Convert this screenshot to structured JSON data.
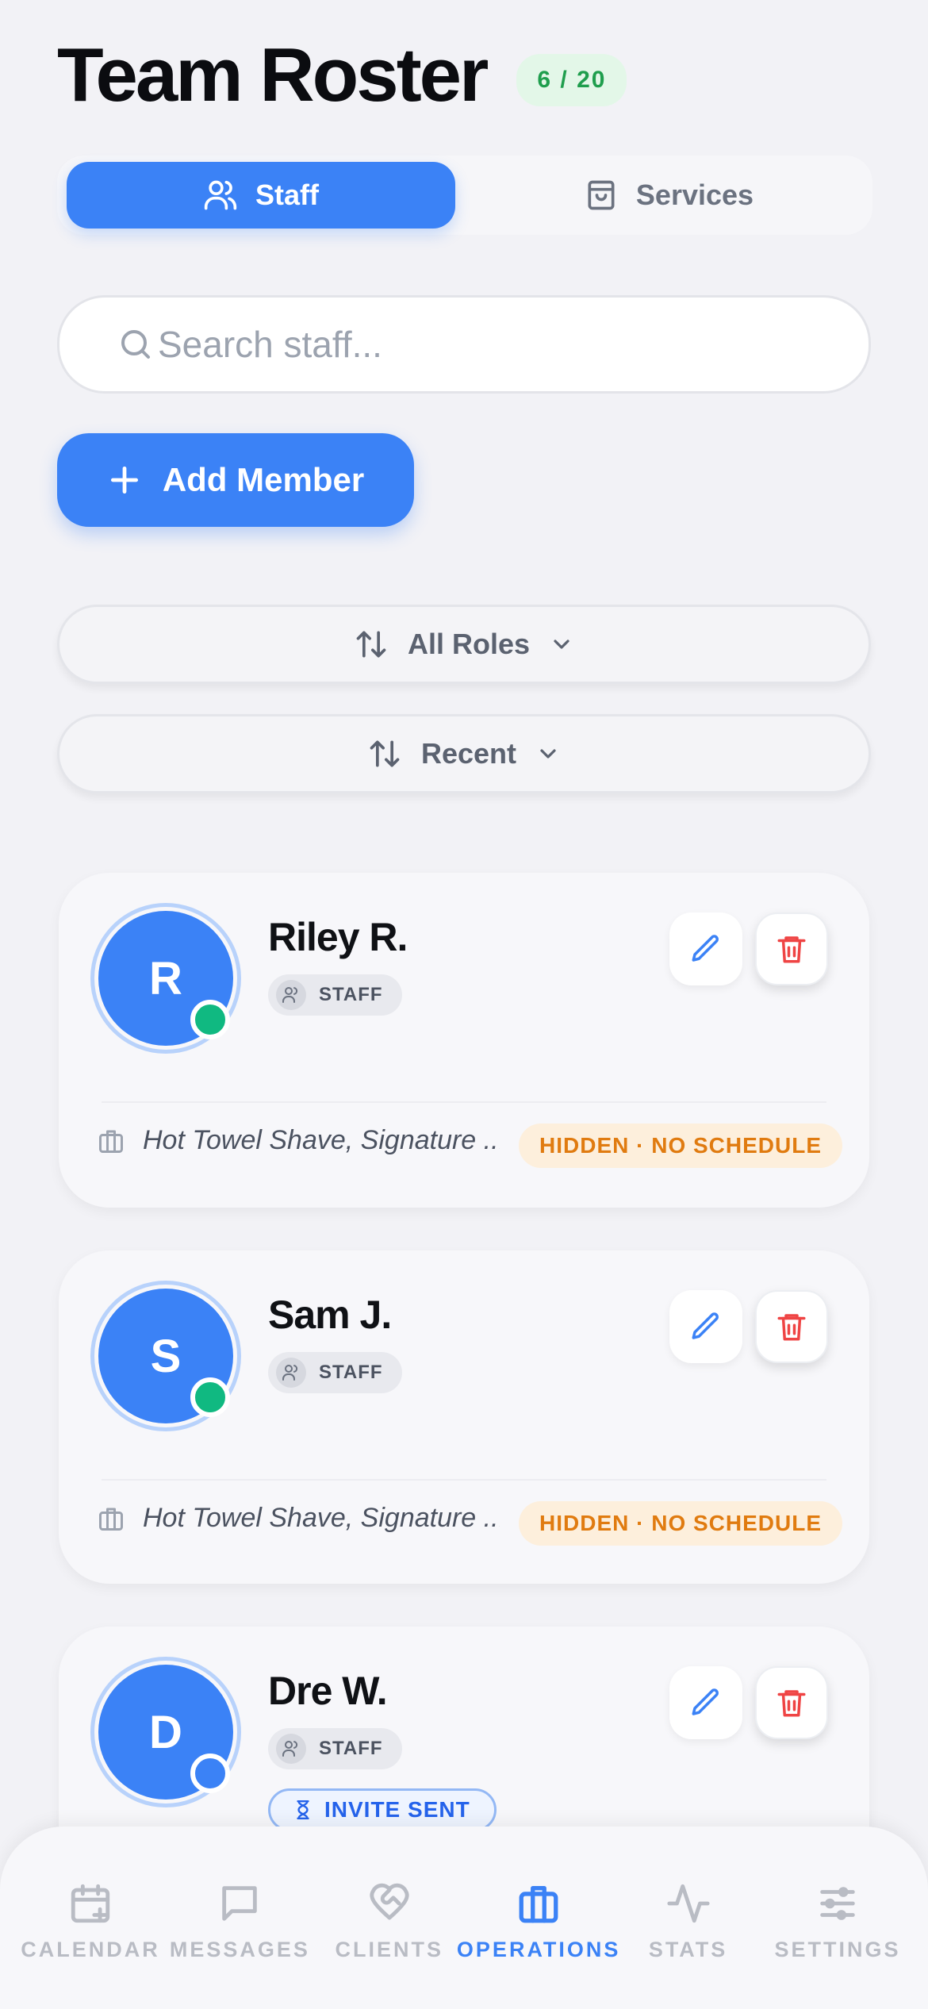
{
  "header": {
    "title": "Team Roster",
    "count": "6 / 20"
  },
  "tabs": [
    {
      "label": "Staff",
      "icon": "users-icon",
      "active": true
    },
    {
      "label": "Services",
      "icon": "shopping-bag-icon",
      "active": false
    }
  ],
  "search": {
    "placeholder": "Search staff...",
    "value": ""
  },
  "add_button": {
    "label": "Add Member"
  },
  "filters": {
    "roles": {
      "label": "All Roles"
    },
    "sort": {
      "label": "Recent"
    }
  },
  "members": [
    {
      "initial": "R",
      "name": "Riley R.",
      "role": "STAFF",
      "status_color": "#10b981",
      "services": "Hot Towel Shave, Signature ...",
      "badge": "HIDDEN · NO SCHEDULE"
    },
    {
      "initial": "S",
      "name": "Sam J.",
      "role": "STAFF",
      "status_color": "#10b981",
      "services": "Hot Towel Shave, Signature ...",
      "badge": "HIDDEN · NO SCHEDULE"
    },
    {
      "initial": "D",
      "name": "Dre W.",
      "role": "STAFF",
      "status_color": "#3b82f6",
      "invite": "INVITE SENT"
    }
  ],
  "nav": [
    {
      "label": "CALENDAR",
      "icon": "calendar-plus-icon",
      "active": false
    },
    {
      "label": "MESSAGES",
      "icon": "message-square-icon",
      "active": false
    },
    {
      "label": "CLIENTS",
      "icon": "heart-handshake-icon",
      "active": false
    },
    {
      "label": "OPERATIONS",
      "icon": "briefcase-icon",
      "active": true
    },
    {
      "label": "STATS",
      "icon": "activity-icon",
      "active": false
    },
    {
      "label": "SETTINGS",
      "icon": "sliders-icon",
      "active": false
    }
  ],
  "colors": {
    "accent": "#3b82f6",
    "online": "#10b981",
    "danger": "#ef4444",
    "warning_text": "#e07b10",
    "warning_bg": "#fdefdc",
    "count_text": "#1f9e4d",
    "count_bg": "#e3f7e8"
  }
}
